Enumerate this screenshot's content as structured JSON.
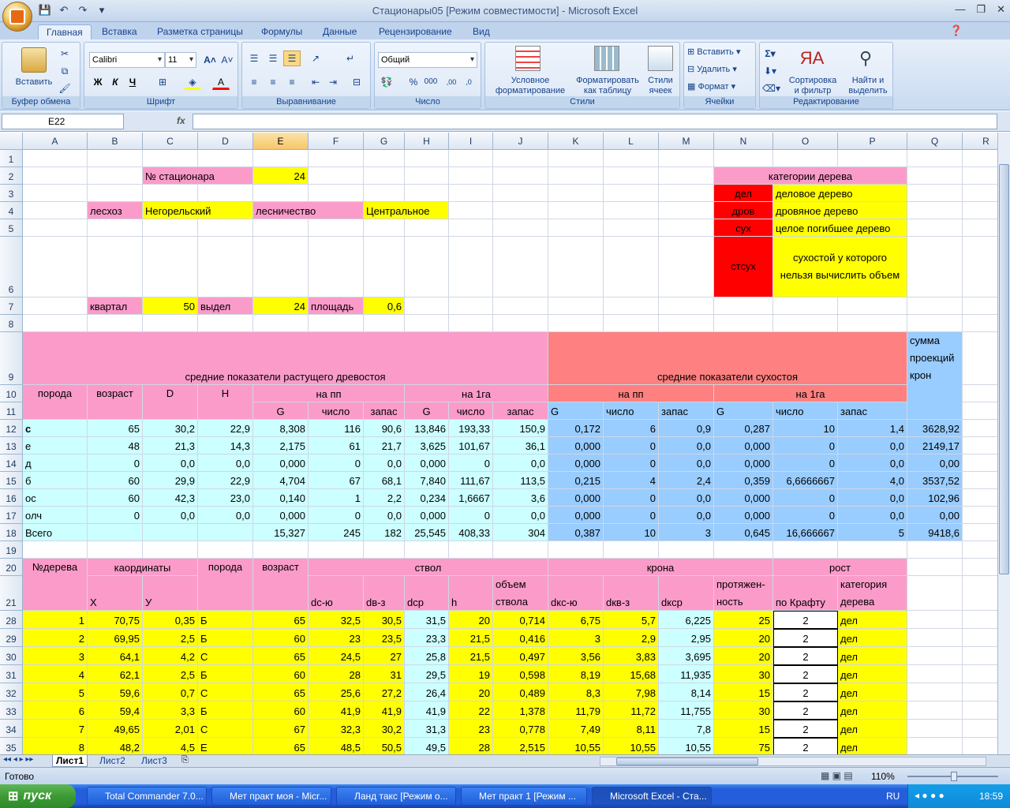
{
  "window": {
    "title": "Стационары05  [Режим совместимости] - Microsoft Excel"
  },
  "tabs": [
    "Главная",
    "Вставка",
    "Разметка страницы",
    "Формулы",
    "Данные",
    "Рецензирование",
    "Вид"
  ],
  "ribbon": {
    "paste": "Вставить",
    "clipboard_label": "Буфер обмена",
    "font_name": "Calibri",
    "font_size": "11",
    "font_label": "Шрифт",
    "align_label": "Выравнивание",
    "number_format": "Общий",
    "number_label": "Число",
    "cond_format": "Условное\nформатирование",
    "format_table": "Форматировать\nкак таблицу",
    "cell_styles": "Стили\nячеек",
    "styles_label": "Стили",
    "insert": "Вставить",
    "delete": "Удалить",
    "format": "Формат",
    "cells_label": "Ячейки",
    "sort": "Сортировка\nи фильтр",
    "find": "Найти и\nвыделить",
    "edit_label": "Редактирование",
    "bold": "Ж",
    "italic": "К",
    "underline": "Ч"
  },
  "formula_bar": {
    "name_box": "E22",
    "fx": "fx",
    "formula": ""
  },
  "columns": [
    "A",
    "B",
    "C",
    "D",
    "E",
    "F",
    "G",
    "H",
    "I",
    "J",
    "K",
    "L",
    "M",
    "N",
    "O",
    "P",
    "Q",
    "R"
  ],
  "rows": [
    "1",
    "2",
    "3",
    "4",
    "5",
    "6",
    "7",
    "8",
    "9",
    "10",
    "11",
    "12",
    "13",
    "14",
    "15",
    "16",
    "17",
    "18",
    "19",
    "20",
    "21",
    "28",
    "29",
    "30",
    "31",
    "32",
    "33",
    "34",
    "35"
  ],
  "cells": {
    "C2": "№ стационара",
    "E2": "24",
    "B4": "лесхоз",
    "C4": "Негорельский",
    "E4": "лесничество",
    "G4": "Центральное",
    "B7": "квартал",
    "C7": "50",
    "D7": "выдел",
    "E7": "24",
    "F7": "площадь",
    "G7": "0,6",
    "N2": "категории дерева",
    "N3": "дел",
    "O3": "деловое дерево",
    "N4": "дров",
    "O4": "дровяное дерево",
    "N5": "сух",
    "O5": "целое погибшее дерево",
    "N6": "стсух",
    "O6": "сухостой у которого нельзя вычислить объем",
    "A9": "средние показатели растущего древостоя",
    "K9": "средние показатели сухостоя",
    "Q9": "сумма проекций крон",
    "A10": "порода",
    "B10": "возраст",
    "C10": "D",
    "D10": "H",
    "E10": "на пп",
    "H10": "на 1га",
    "K10": "на пп",
    "N10": "на 1га",
    "E11": "G",
    "F11": "число",
    "G11": "запас",
    "H11": "G",
    "I11": "число",
    "J11": "запас",
    "K11": "G",
    "L11": "число",
    "M11": "запас",
    "N11": "G",
    "O11": "число",
    "P11": "запас"
  },
  "summary_rows": [
    [
      "с",
      "65",
      "30,2",
      "22,9",
      "8,308",
      "116",
      "90,6",
      "13,846",
      "193,33",
      "150,9",
      "0,172",
      "6",
      "0,9",
      "0,287",
      "10",
      "1,4",
      "3628,92"
    ],
    [
      "е",
      "48",
      "21,3",
      "14,3",
      "2,175",
      "61",
      "21,7",
      "3,625",
      "101,67",
      "36,1",
      "0,000",
      "0",
      "0,0",
      "0,000",
      "0",
      "0,0",
      "2149,17"
    ],
    [
      "д",
      "0",
      "0,0",
      "0,0",
      "0,000",
      "0",
      "0,0",
      "0,000",
      "0",
      "0,0",
      "0,000",
      "0",
      "0,0",
      "0,000",
      "0",
      "0,0",
      "0,00"
    ],
    [
      "б",
      "60",
      "29,9",
      "22,9",
      "4,704",
      "67",
      "68,1",
      "7,840",
      "111,67",
      "113,5",
      "0,215",
      "4",
      "2,4",
      "0,359",
      "6,6666667",
      "4,0",
      "3537,52"
    ],
    [
      "ос",
      "60",
      "42,3",
      "23,0",
      "0,140",
      "1",
      "2,2",
      "0,234",
      "1,6667",
      "3,6",
      "0,000",
      "0",
      "0,0",
      "0,000",
      "0",
      "0,0",
      "102,96"
    ],
    [
      "олч",
      "0",
      "0,0",
      "0,0",
      "0,000",
      "0",
      "0,0",
      "0,000",
      "0",
      "0,0",
      "0,000",
      "0",
      "0,0",
      "0,000",
      "0",
      "0,0",
      "0,00"
    ],
    [
      "Всего",
      "",
      "",
      "",
      "15,327",
      "245",
      "182",
      "25,545",
      "408,33",
      "304",
      "0,387",
      "10",
      "3",
      "0,645",
      "16,666667",
      "5",
      "9418,6"
    ]
  ],
  "tree_headers": {
    "A20": "№дерева",
    "B20": "каординаты",
    "D20": "порода",
    "E20": "возраст",
    "F20": "ствол",
    "K20": "крона",
    "O20": "рост",
    "B21": "X",
    "C21": "У",
    "F21": "dс-ю",
    "G21": "dв-з",
    "H21": "dср",
    "I21": "h",
    "J21": "объем ствола",
    "K21": "dкс-ю",
    "L21": "dкв-з",
    "M21": "dкср",
    "N21": "протяжен-ность",
    "O21": "по Крафту",
    "P21": "категория дерева"
  },
  "tree_rows": [
    [
      "1",
      "70,75",
      "0,35",
      "Б",
      "65",
      "32,5",
      "30,5",
      "31,5",
      "20",
      "0,714",
      "6,75",
      "5,7",
      "6,225",
      "25",
      "2",
      "дел"
    ],
    [
      "2",
      "69,95",
      "2,5",
      "Б",
      "60",
      "23",
      "23,5",
      "23,3",
      "21,5",
      "0,416",
      "3",
      "2,9",
      "2,95",
      "20",
      "2",
      "дел"
    ],
    [
      "3",
      "64,1",
      "4,2",
      "С",
      "65",
      "24,5",
      "27",
      "25,8",
      "21,5",
      "0,497",
      "3,56",
      "3,83",
      "3,695",
      "20",
      "2",
      "дел"
    ],
    [
      "4",
      "62,1",
      "2,5",
      "Б",
      "60",
      "28",
      "31",
      "29,5",
      "19",
      "0,598",
      "8,19",
      "15,68",
      "11,935",
      "30",
      "2",
      "дел"
    ],
    [
      "5",
      "59,6",
      "0,7",
      "С",
      "65",
      "25,6",
      "27,2",
      "26,4",
      "20",
      "0,489",
      "8,3",
      "7,98",
      "8,14",
      "15",
      "2",
      "дел"
    ],
    [
      "6",
      "59,4",
      "3,3",
      "Б",
      "60",
      "41,9",
      "41,9",
      "41,9",
      "22",
      "1,378",
      "11,79",
      "11,72",
      "11,755",
      "30",
      "2",
      "дел"
    ],
    [
      "7",
      "49,65",
      "2,01",
      "С",
      "67",
      "32,3",
      "30,2",
      "31,3",
      "23",
      "0,778",
      "7,49",
      "8,11",
      "7,8",
      "15",
      "2",
      "дел"
    ],
    [
      "8",
      "48,2",
      "4,5",
      "Е",
      "65",
      "48,5",
      "50,5",
      "49,5",
      "28",
      "2,515",
      "10,55",
      "10,55",
      "10,55",
      "75",
      "2",
      "дел"
    ]
  ],
  "sheets": [
    "Лист1",
    "Лист2",
    "Лист3"
  ],
  "status": {
    "ready": "Готово",
    "zoom": "110%"
  },
  "taskbar": {
    "start": "пуск",
    "tasks": [
      "Total Commander 7.0...",
      "Мет практ моя - Micr...",
      "Ланд такс [Режим о...",
      "Мет практ 1 [Режим ...",
      "Microsoft Excel - Ста..."
    ],
    "lang": "RU",
    "time": "18:59"
  }
}
